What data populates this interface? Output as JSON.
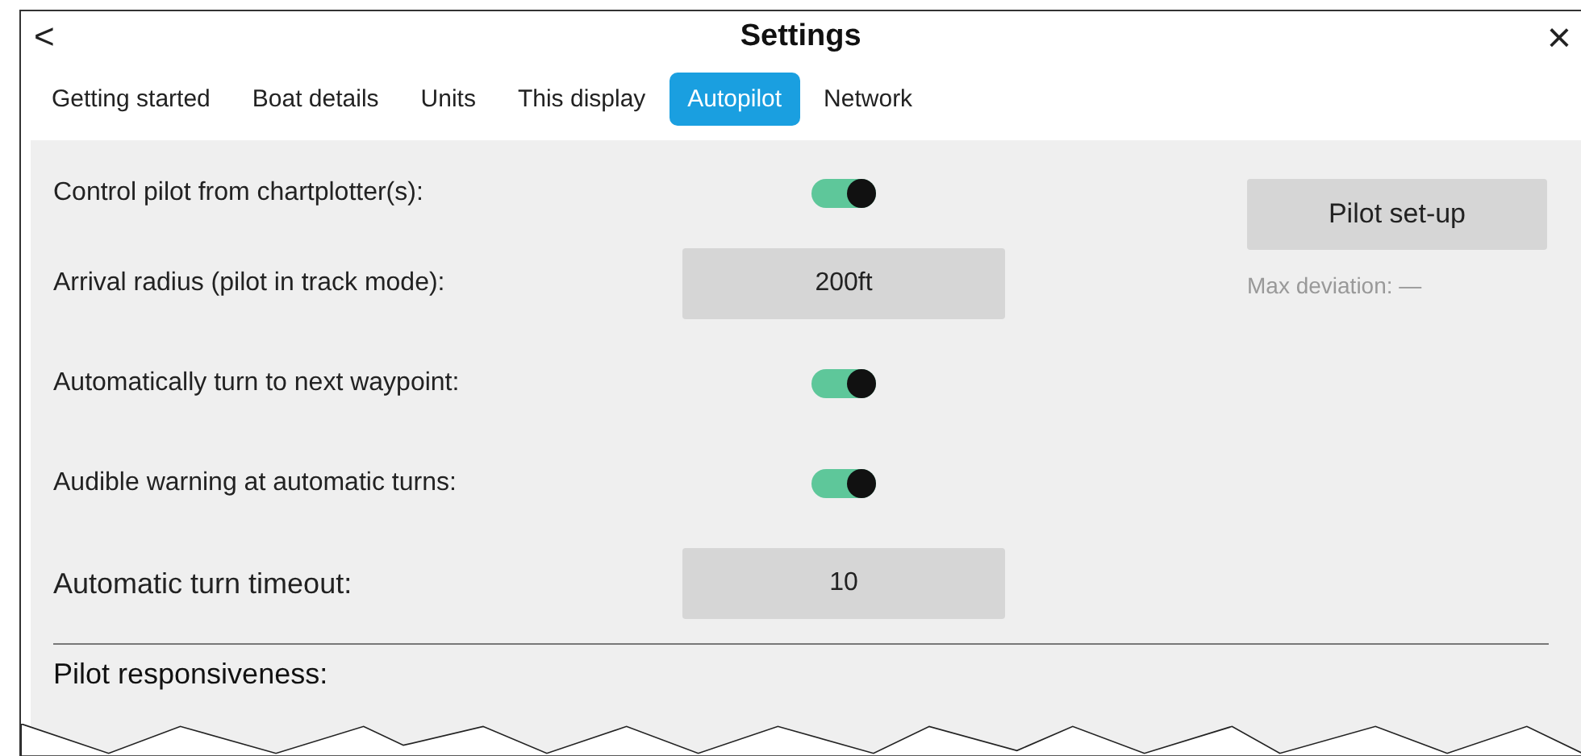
{
  "window": {
    "back": "<",
    "title": "Settings",
    "close": "×"
  },
  "tabs": [
    {
      "label": "Getting started",
      "selected": false
    },
    {
      "label": "Boat details",
      "selected": false
    },
    {
      "label": "Units",
      "selected": false
    },
    {
      "label": "This display",
      "selected": false
    },
    {
      "label": "Autopilot",
      "selected": true
    },
    {
      "label": "Network",
      "selected": false
    }
  ],
  "settings": [
    {
      "kind": "toggle",
      "label": "Control pilot from chartplotter(s):",
      "on": true
    },
    {
      "kind": "value",
      "label": "Arrival radius (pilot in track mode):",
      "value": "200ft"
    },
    {
      "kind": "toggle",
      "label": "Automatically turn to next waypoint:",
      "on": true
    },
    {
      "kind": "toggle",
      "label": "Audible warning at automatic turns:",
      "on": true
    },
    {
      "kind": "value",
      "label": "Automatic turn timeout:",
      "value": "10"
    }
  ],
  "side": {
    "button": "Pilot set-up",
    "note": "Max deviation: —"
  },
  "next_section": "Pilot responsiveness:"
}
